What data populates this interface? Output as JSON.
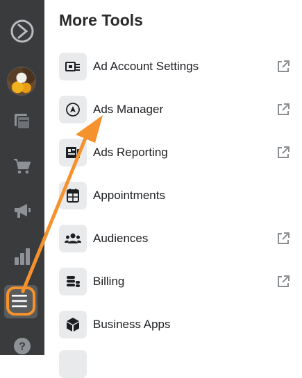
{
  "sidebar": {
    "items": [
      {
        "icon": "logo-circle-arrow-icon"
      },
      {
        "icon": "profile-avatar"
      },
      {
        "icon": "pages-stack-icon"
      },
      {
        "icon": "shopping-cart-icon"
      },
      {
        "icon": "megaphone-icon"
      },
      {
        "icon": "bar-chart-icon"
      },
      {
        "icon": "hamburger-menu-icon",
        "active": true
      },
      {
        "icon": "help-question-icon"
      }
    ]
  },
  "main": {
    "title": "More Tools",
    "tools": [
      {
        "label": "Ad Account Settings",
        "icon": "ad-settings-icon",
        "external": true
      },
      {
        "label": "Ads Manager",
        "icon": "navigation-arrow-icon",
        "external": true
      },
      {
        "label": "Ads Reporting",
        "icon": "report-icon",
        "external": true
      },
      {
        "label": "Appointments",
        "icon": "calendar-grid-icon",
        "external": false
      },
      {
        "label": "Audiences",
        "icon": "people-group-icon",
        "external": true
      },
      {
        "label": "Billing",
        "icon": "coins-stack-icon",
        "external": true
      },
      {
        "label": "Business Apps",
        "icon": "cube-icon",
        "external": false
      }
    ]
  },
  "annotation": {
    "color": "#f5922d"
  },
  "colors": {
    "sidebar_bg": "#3a3b3c",
    "highlight": "#f5922d"
  }
}
